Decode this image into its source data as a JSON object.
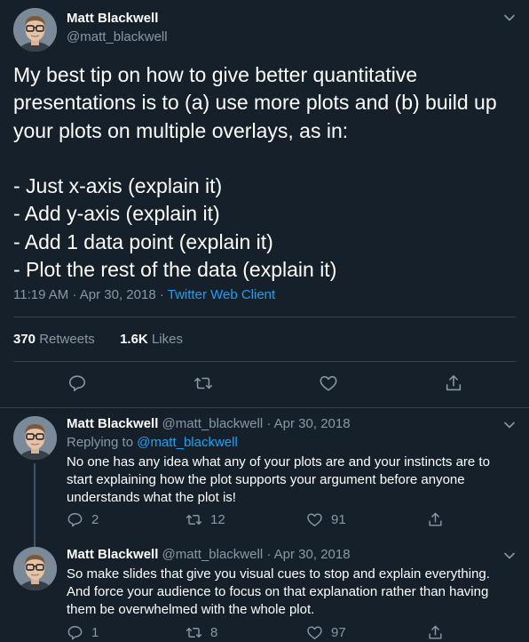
{
  "main_tweet": {
    "author_name": "Matt Blackwell",
    "author_handle": "@matt_blackwell",
    "text_lines": [
      "My best tip on how to give better quantitative",
      "presentations is to (a) use more plots and (b) build up",
      "your plots on multiple overlays, as in:",
      "",
      "- Just x-axis (explain it)",
      "- Add y-axis (explain it)",
      "- Add 1 data point (explain it)",
      "- Plot the rest of the data (explain it)"
    ],
    "time": "11:19 AM",
    "date": "Apr 30, 2018",
    "separator": "·",
    "client": "Twitter Web Client",
    "retweets_count": "370",
    "retweets_label": "Retweets",
    "likes_count": "1.6K",
    "likes_label": "Likes"
  },
  "replies": [
    {
      "author_name": "Matt Blackwell",
      "author_handle": "@matt_blackwell",
      "date": "Apr 30, 2018",
      "replying_to_label": "Replying to",
      "replying_to_handle": "@matt_blackwell",
      "text_lines": [
        "No one has any idea what any of your plots are and your instincts are to",
        "start explaining how the plot supports your argument before anyone",
        "understands what the plot is!"
      ],
      "reply_count": "2",
      "retweet_count": "12",
      "like_count": "91"
    },
    {
      "author_name": "Matt Blackwell",
      "author_handle": "@matt_blackwell",
      "date": "Apr 30, 2018",
      "text_lines": [
        "So make slides that give you visual cues to stop and explain everything.",
        "And force your audience to focus on that explanation rather than having",
        "them be overwhelmed with the whole plot."
      ],
      "reply_count": "1",
      "retweet_count": "8",
      "like_count": "97"
    }
  ],
  "icons": {
    "reply": "reply-icon",
    "retweet": "retweet-icon",
    "like": "heart-icon",
    "share": "share-icon",
    "more": "chevron-down-icon"
  },
  "colors": {
    "background": "#15202b",
    "accent": "#1da1f2",
    "muted": "#8899a6",
    "border": "#38444d"
  }
}
